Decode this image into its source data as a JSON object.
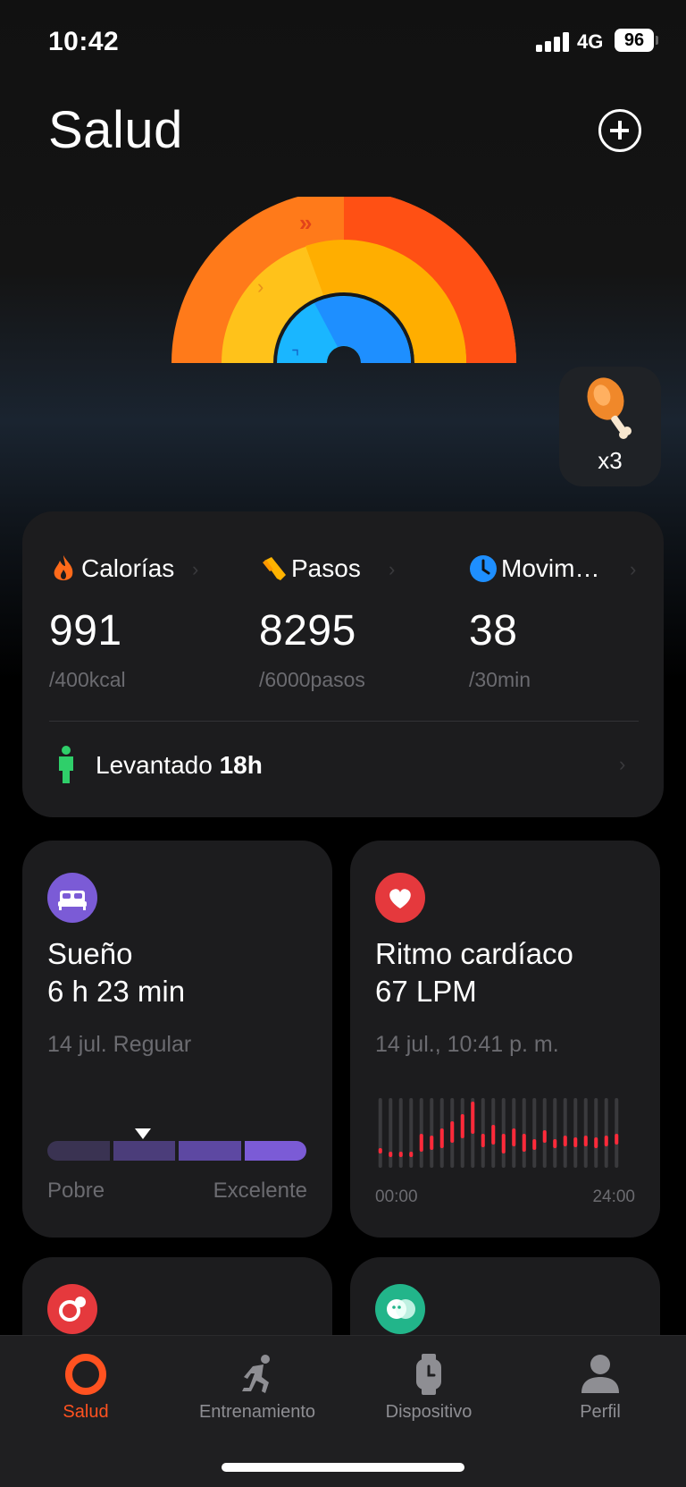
{
  "status_bar": {
    "time": "10:42",
    "network": "4G",
    "battery": "96"
  },
  "header": {
    "title": "Salud"
  },
  "badge": {
    "count": "x3"
  },
  "activity": {
    "metrics": [
      {
        "label": "Calorías",
        "value": "991",
        "goal": "/400kcal",
        "icon": "flame-icon",
        "color": "#ff6a1a"
      },
      {
        "label": "Pasos",
        "value": "8295",
        "goal": "/6000pasos",
        "icon": "shoe-icon",
        "color": "#ffb300"
      },
      {
        "label": "Movim…",
        "value": "38",
        "goal": "/30min",
        "icon": "clock-icon",
        "color": "#1e8fff"
      }
    ],
    "stand": {
      "label": "Levantado",
      "value": "18h"
    }
  },
  "sleep": {
    "title": "Sueño",
    "value": "6 h 23 min",
    "date": "14 jul. Regular",
    "scale_low": "Pobre",
    "scale_high": "Excelente",
    "quality_fraction": 0.36
  },
  "heart": {
    "title": "Ritmo cardíaco",
    "value": "67 LPM",
    "date": "14 jul., 10:41 p. m.",
    "axis_start": "00:00",
    "axis_end": "24:00"
  },
  "tabs": [
    {
      "label": "Salud",
      "icon": "ring-icon",
      "active": true
    },
    {
      "label": "Entrenamiento",
      "icon": "runner-icon",
      "active": false
    },
    {
      "label": "Dispositivo",
      "icon": "watch-icon",
      "active": false
    },
    {
      "label": "Perfil",
      "icon": "person-icon",
      "active": false
    }
  ],
  "colors": {
    "accent": "#ff5220",
    "calories": "#ff6a1a",
    "steps": "#ffb300",
    "move": "#1e8fff",
    "sleep": "#7b5bd6",
    "heart": "#e5393d",
    "spo2": "#e5393d",
    "stress": "#22b58a"
  }
}
